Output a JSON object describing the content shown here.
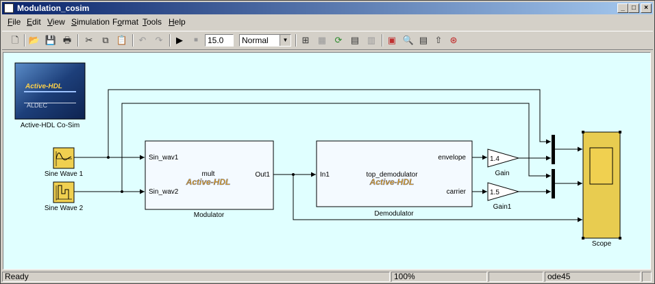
{
  "window": {
    "title": "Modulation_cosim"
  },
  "menu": [
    "File",
    "Edit",
    "View",
    "Simulation",
    "Format",
    "Tools",
    "Help"
  ],
  "menu_underline": [
    "F",
    "E",
    "V",
    "S",
    "o",
    "T",
    "H"
  ],
  "toolbar": {
    "stop_time": "15.0",
    "sim_mode": "Normal"
  },
  "blocks": {
    "cosim": {
      "label": "Active-HDL Co-Sim",
      "logo_top": "Active-HDL",
      "logo_bottom": "ALDEC"
    },
    "sine1": {
      "label": "Sine Wave 1"
    },
    "sine2": {
      "label": "Sine Wave 2"
    },
    "modulator": {
      "label": "Modulator",
      "entity": "mult",
      "in1": "Sin_wav1",
      "in2": "Sin_wav2",
      "out1": "Out1",
      "logo": "Active-HDL"
    },
    "demodulator": {
      "label": "Demodulator",
      "entity": "top_demodulator",
      "in1": "In1",
      "out1": "envelope",
      "out2": "carrier",
      "logo": "Active-HDL"
    },
    "gain": {
      "label": "Gain",
      "value": "1.4"
    },
    "gain1": {
      "label": "Gain1",
      "value": "1.5"
    },
    "scope": {
      "label": "Scope"
    }
  },
  "status": {
    "state": "Ready",
    "zoom": "100%",
    "solver": "ode45"
  },
  "colors": {
    "canvas": "#e0ffff",
    "source_block": "#f0d050",
    "scope_block": "#e8cc50",
    "subsystem_bg": "#f4faff"
  }
}
